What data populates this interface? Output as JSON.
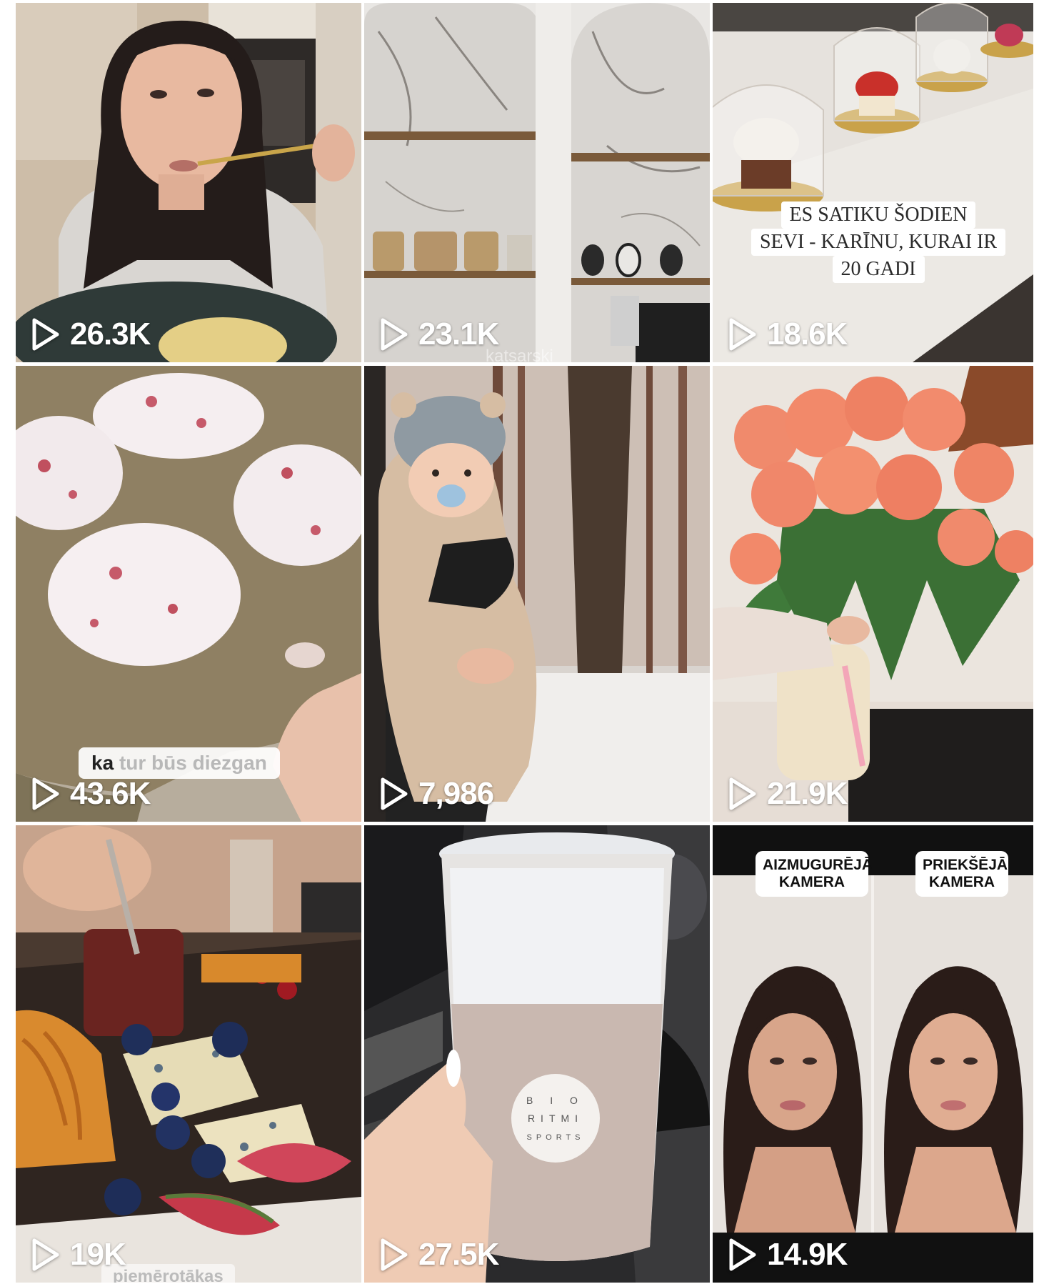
{
  "tiles": [
    {
      "id": "tile-1",
      "views": "26.3K"
    },
    {
      "id": "tile-2",
      "views": "23.1K",
      "faint_text": "katsarski"
    },
    {
      "id": "tile-3",
      "views": "18.6K",
      "caption_lines": [
        "ES SATIKU ŠODIEN",
        "SEVI - KARĪNU, KURAI IR",
        "20 GADI"
      ]
    },
    {
      "id": "tile-4",
      "views": "43.6K",
      "caption_part1": "ka",
      "caption_part2": "tur būs diezgan"
    },
    {
      "id": "tile-5",
      "views": "7,986"
    },
    {
      "id": "tile-6",
      "views": "21.9K"
    },
    {
      "id": "tile-7",
      "views": "19K",
      "caption": "piemērotākas"
    },
    {
      "id": "tile-8",
      "views": "27.5K",
      "cup_logo": "BIO RITMI SPORTS"
    },
    {
      "id": "tile-9",
      "views": "14.9K",
      "label_left": "AIZMUGURĒJĀ KAMERA",
      "label_right": "PRIEKŠĒJĀ KAMERA"
    }
  ]
}
